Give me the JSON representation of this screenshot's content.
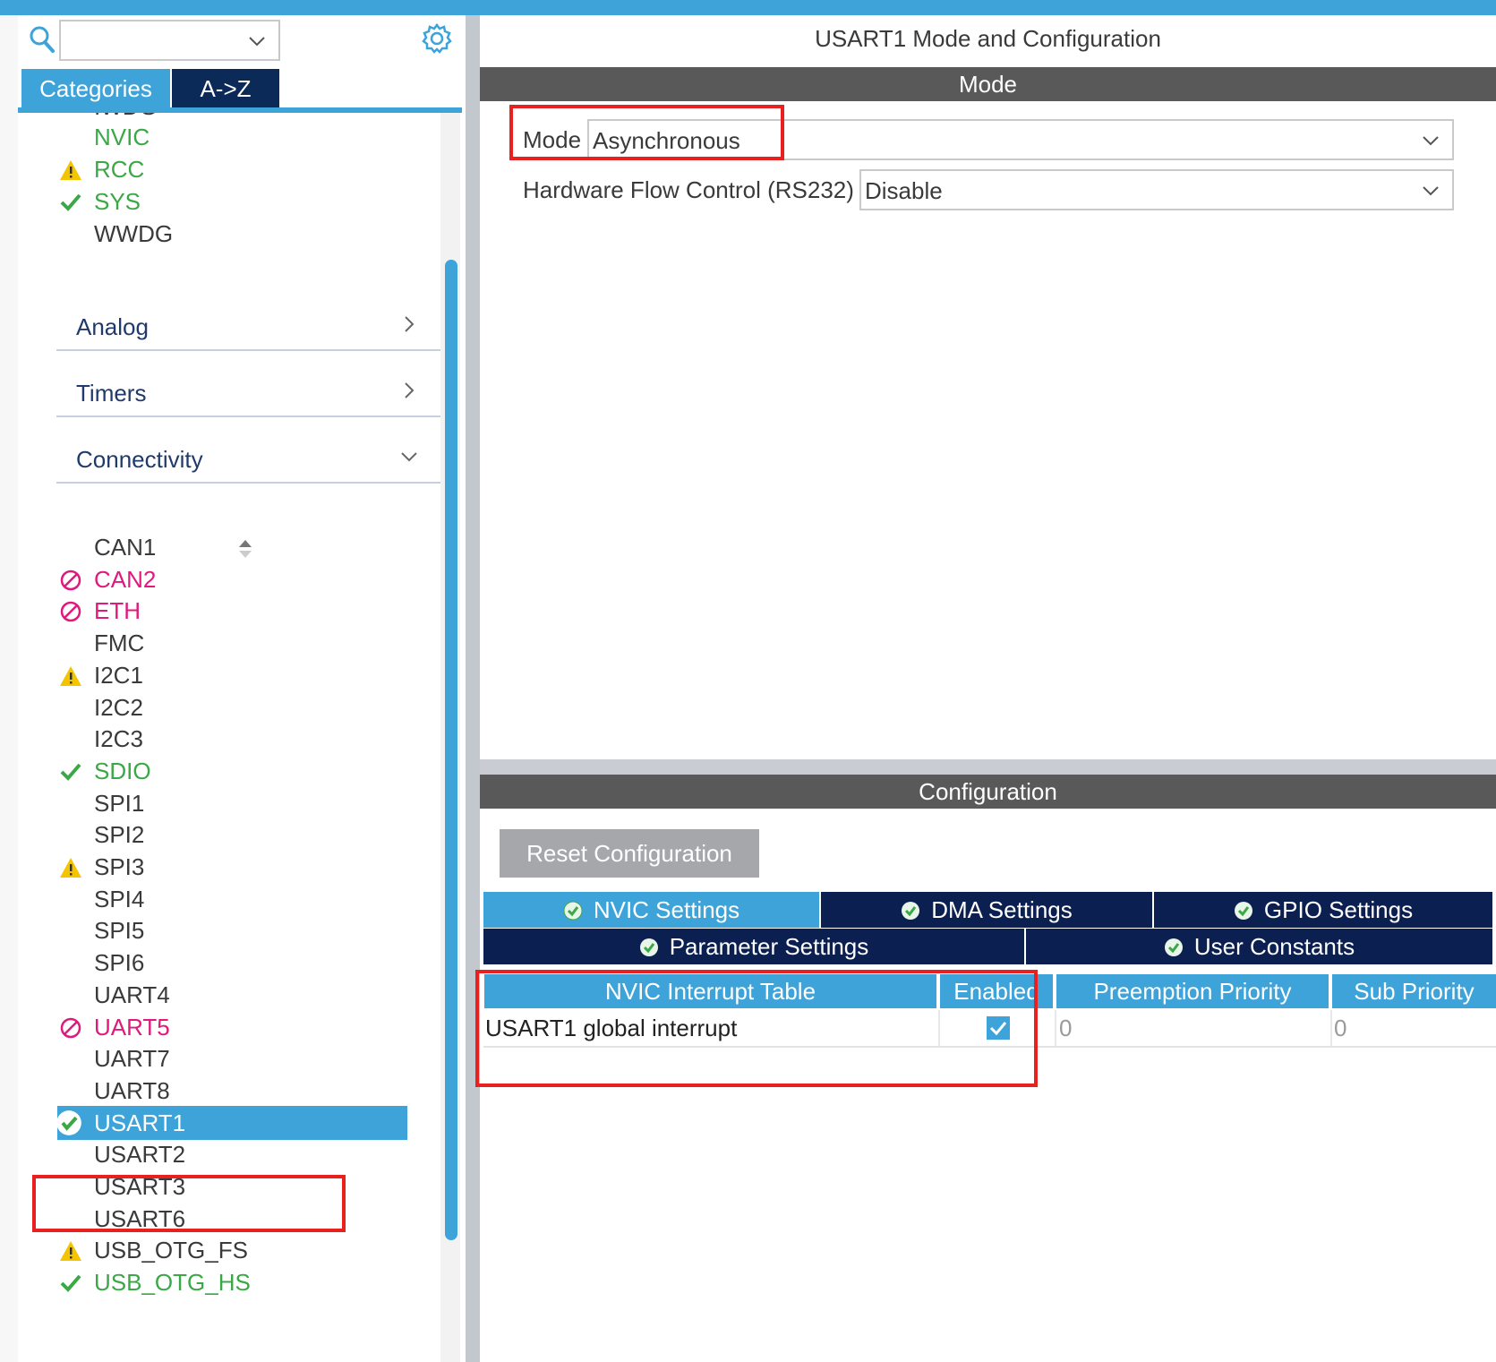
{
  "left_panel": {
    "search_value": "",
    "tabs": {
      "categories": "Categories",
      "az": "A->Z"
    },
    "items_top": [
      {
        "label": "IWDG",
        "status": "none"
      },
      {
        "label": "NVIC",
        "status": "ok-text"
      },
      {
        "label": "RCC",
        "status": "warning"
      },
      {
        "label": "SYS",
        "status": "ok"
      },
      {
        "label": "WWDG",
        "status": "none"
      }
    ],
    "sections": {
      "analog": "Analog",
      "timers": "Timers",
      "connectivity": "Connectivity"
    },
    "connectivity_items": [
      {
        "label": "CAN1",
        "status": "none"
      },
      {
        "label": "CAN2",
        "status": "disabled"
      },
      {
        "label": "ETH",
        "status": "disabled"
      },
      {
        "label": "FMC",
        "status": "none"
      },
      {
        "label": "I2C1",
        "status": "warning"
      },
      {
        "label": "I2C2",
        "status": "none"
      },
      {
        "label": "I2C3",
        "status": "none"
      },
      {
        "label": "SDIO",
        "status": "ok"
      },
      {
        "label": "SPI1",
        "status": "none"
      },
      {
        "label": "SPI2",
        "status": "none"
      },
      {
        "label": "SPI3",
        "status": "warning"
      },
      {
        "label": "SPI4",
        "status": "none"
      },
      {
        "label": "SPI5",
        "status": "none"
      },
      {
        "label": "SPI6",
        "status": "none"
      },
      {
        "label": "UART4",
        "status": "none"
      },
      {
        "label": "UART5",
        "status": "disabled"
      },
      {
        "label": "UART7",
        "status": "none"
      },
      {
        "label": "UART8",
        "status": "none"
      },
      {
        "label": "USART1",
        "status": "selected-ok"
      },
      {
        "label": "USART2",
        "status": "none"
      },
      {
        "label": "USART3",
        "status": "none"
      },
      {
        "label": "USART6",
        "status": "none"
      },
      {
        "label": "USB_OTG_FS",
        "status": "warning"
      },
      {
        "label": "USB_OTG_HS",
        "status": "ok"
      }
    ]
  },
  "right_panel": {
    "title": "USART1 Mode and Configuration",
    "mode_bar": "Mode",
    "mode_label": "Mode",
    "mode_value": "Asynchronous",
    "flow_label": "Hardware Flow Control (RS232)",
    "flow_value": "Disable",
    "config_bar": "Configuration",
    "reset_button": "Reset Configuration",
    "config_tabs": {
      "nvic": "NVIC Settings",
      "dma": "DMA Settings",
      "gpio": "GPIO Settings",
      "parameter": "Parameter Settings",
      "user_constants": "User Constants"
    },
    "nvic_table": {
      "headers": [
        "NVIC Interrupt Table",
        "Enabled",
        "Preemption Priority",
        "Sub Priority"
      ],
      "rows": [
        {
          "name": "USART1 global interrupt",
          "enabled": true,
          "preemption": "0",
          "sub": "0"
        }
      ]
    }
  },
  "colors": {
    "accent": "#3da3d9",
    "dark_tab": "#0b2050",
    "bar": "#595959",
    "ok": "#3aa845",
    "warning": "#f5c400",
    "disabled": "#e0197d",
    "highlight": "#e8201f"
  }
}
